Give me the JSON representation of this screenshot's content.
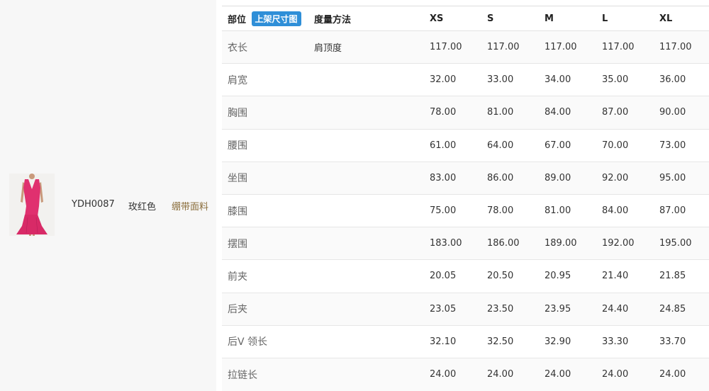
{
  "product": {
    "code": "YDH0087",
    "color": "玫红色",
    "fabric": "绷带面料",
    "image_desc": "dress-thumbnail"
  },
  "table": {
    "headers": {
      "part": "部位",
      "size_chart_button": "上架尺寸图",
      "method": "度量方法",
      "sizes": [
        "XS",
        "S",
        "M",
        "L",
        "XL"
      ]
    },
    "rows": [
      {
        "part": "衣长",
        "method": "肩顶度",
        "values": [
          "117.00",
          "117.00",
          "117.00",
          "117.00",
          "117.00"
        ]
      },
      {
        "part": "肩宽",
        "method": "",
        "values": [
          "32.00",
          "33.00",
          "34.00",
          "35.00",
          "36.00"
        ]
      },
      {
        "part": "胸围",
        "method": "",
        "values": [
          "78.00",
          "81.00",
          "84.00",
          "87.00",
          "90.00"
        ]
      },
      {
        "part": "腰围",
        "method": "",
        "values": [
          "61.00",
          "64.00",
          "67.00",
          "70.00",
          "73.00"
        ]
      },
      {
        "part": "坐围",
        "method": "",
        "values": [
          "83.00",
          "86.00",
          "89.00",
          "92.00",
          "95.00"
        ]
      },
      {
        "part": "膝围",
        "method": "",
        "values": [
          "75.00",
          "78.00",
          "81.00",
          "84.00",
          "87.00"
        ]
      },
      {
        "part": "摆围",
        "method": "",
        "values": [
          "183.00",
          "186.00",
          "189.00",
          "192.00",
          "195.00"
        ]
      },
      {
        "part": "前夹",
        "method": "",
        "values": [
          "20.05",
          "20.50",
          "20.95",
          "21.40",
          "21.85"
        ]
      },
      {
        "part": "后夹",
        "method": "",
        "values": [
          "23.05",
          "23.50",
          "23.95",
          "24.40",
          "24.85"
        ]
      },
      {
        "part": "后V 领长",
        "method": "",
        "values": [
          "32.10",
          "32.50",
          "32.90",
          "33.30",
          "33.70"
        ]
      },
      {
        "part": "拉链长",
        "method": "",
        "values": [
          "24.00",
          "24.00",
          "24.00",
          "24.00",
          "24.00"
        ]
      }
    ]
  },
  "colors": {
    "accent_button": "#2f8fd8",
    "dress": "#e0306f"
  }
}
